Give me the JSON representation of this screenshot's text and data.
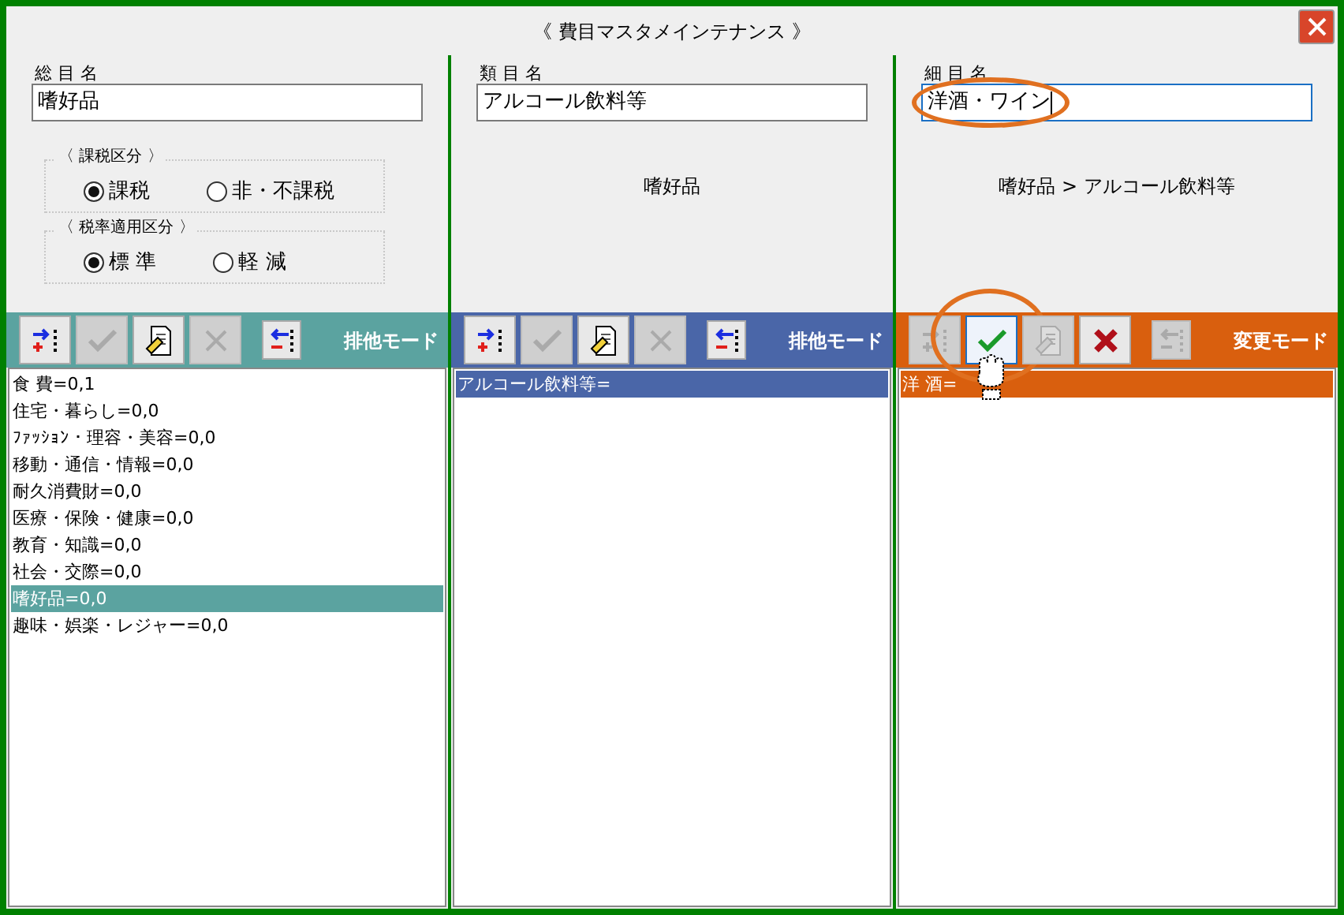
{
  "window": {
    "title": "《 費目マスタメインテナンス 》"
  },
  "panes": [
    {
      "label": "総 目 名",
      "value": "嗜好品",
      "focused": false,
      "color": "#5ba3a0",
      "mode": "排他モード",
      "radio_groups": [
        {
          "title": "〈 課税区分 〉",
          "options": [
            {
              "label": "課税",
              "selected": true
            },
            {
              "label": "非・不課税",
              "selected": false
            }
          ]
        },
        {
          "title": "〈 税率適用区分 〉",
          "options": [
            {
              "label": "標 準",
              "selected": true
            },
            {
              "label": "軽 減",
              "selected": false
            }
          ]
        }
      ],
      "buttons": [
        {
          "kind": "add",
          "disabled": false,
          "focused": false
        },
        {
          "kind": "confirm",
          "disabled": true,
          "focused": false
        },
        {
          "kind": "edit",
          "disabled": false,
          "focused": false
        },
        {
          "kind": "delete",
          "disabled": true,
          "focused": false
        },
        {
          "kind": "remove",
          "disabled": false,
          "focused": false
        }
      ],
      "items": [
        {
          "label": "食 費=0,1",
          "selected": false
        },
        {
          "label": "住宅・暮らし=0,0",
          "selected": false
        },
        {
          "label": "ﾌｧｯｼｮﾝ・理容・美容=0,0",
          "selected": false
        },
        {
          "label": "移動・通信・情報=0,0",
          "selected": false
        },
        {
          "label": "耐久消費財=0,0",
          "selected": false
        },
        {
          "label": "医療・保険・健康=0,0",
          "selected": false
        },
        {
          "label": "教育・知識=0,0",
          "selected": false
        },
        {
          "label": "社会・交際=0,0",
          "selected": false
        },
        {
          "label": "嗜好品=0,0",
          "selected": true
        },
        {
          "label": "趣味・娯楽・レジャー=0,0",
          "selected": false
        }
      ]
    },
    {
      "label": "類 目 名",
      "value": "アルコール飲料等",
      "focused": false,
      "path": "嗜好品",
      "color": "#4a66a8",
      "mode": "排他モード",
      "buttons": [
        {
          "kind": "add",
          "disabled": false,
          "focused": false
        },
        {
          "kind": "confirm",
          "disabled": true,
          "focused": false
        },
        {
          "kind": "edit",
          "disabled": false,
          "focused": false
        },
        {
          "kind": "delete",
          "disabled": true,
          "focused": false
        },
        {
          "kind": "remove",
          "disabled": false,
          "focused": false
        }
      ],
      "items": [
        {
          "label": "アルコール飲料等=",
          "selected": true
        }
      ]
    },
    {
      "label": "細 目 名",
      "value": "洋酒・ワイン",
      "focused": true,
      "circled": true,
      "path": "嗜好品 > アルコール飲料等",
      "color": "#d95f0e",
      "mode": "変更モード",
      "buttons": [
        {
          "kind": "add",
          "disabled": true,
          "focused": false
        },
        {
          "kind": "confirm",
          "disabled": false,
          "focused": true,
          "circled": true,
          "pointer": true
        },
        {
          "kind": "edit",
          "disabled": true,
          "focused": false
        },
        {
          "kind": "delete",
          "disabled": false,
          "focused": false
        },
        {
          "kind": "remove",
          "disabled": true,
          "focused": false
        }
      ],
      "items": [
        {
          "label": "洋 酒=",
          "selected": true
        }
      ]
    }
  ]
}
